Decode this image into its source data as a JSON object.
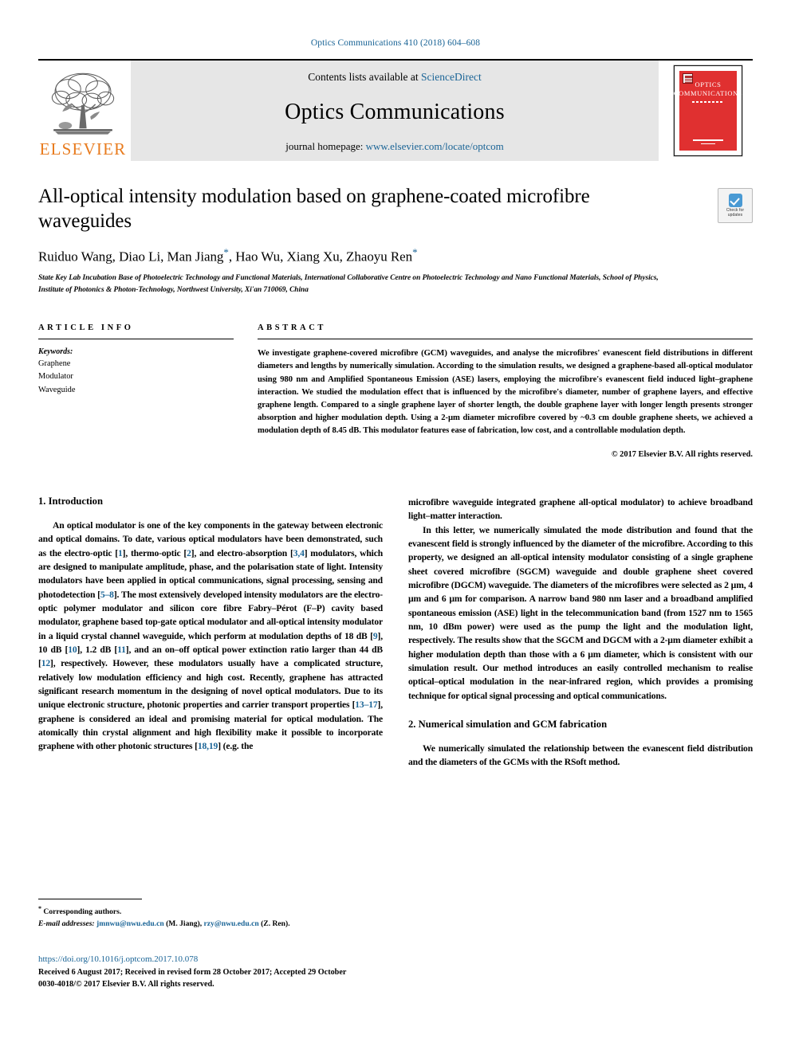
{
  "running_head": "Optics Communications 410 (2018) 604–608",
  "masthead": {
    "contents_prefix": "Contents lists available at ",
    "sciencedirect": "ScienceDirect",
    "journal_name": "Optics Communications",
    "homepage_prefix": "journal homepage: ",
    "homepage_url": "www.elsevier.com/locate/optcom",
    "publisher_wordmark": "ELSEVIER",
    "cover_title": "Optics Communications"
  },
  "article": {
    "title": "All-optical intensity modulation based on graphene-coated microfibre waveguides",
    "authors": "Ruiduo Wang, Diao Li, Man Jiang",
    "authors_mid": ", Hao Wu, Xiang Xu, Zhaoyu Ren",
    "corresponding_mark": "*",
    "affiliation": "State Key Lab Incubation Base of Photoelectric Technology and Functional Materials, International Collaborative Centre on Photoelectric Technology and Nano Functional Materials, School of Physics, Institute of Photonics & Photon-Technology, Northwest University, Xi'an 710069, China",
    "crossmark_label": "Check for updates"
  },
  "article_info": {
    "heading": "ARTICLE INFO",
    "keywords_label": "Keywords:",
    "keywords": [
      "Graphene",
      "Modulator",
      "Waveguide"
    ]
  },
  "abstract": {
    "heading": "ABSTRACT",
    "text": "We investigate graphene-covered microfibre (GCM) waveguides, and analyse the microfibres' evanescent field distributions in different diameters and lengths by numerically simulation. According to the simulation results, we designed a graphene-based all-optical modulator using 980 nm and Amplified Spontaneous Emission (ASE) lasers, employing the microfibre's evanescent field induced light–graphene interaction. We studied the modulation effect that is influenced by the microfibre's diameter, number of graphene layers, and effective graphene length. Compared to a single graphene layer of shorter length, the double graphene layer with longer length presents stronger absorption and higher modulation depth. Using a 2-µm diameter microfibre covered by ~0.3 cm double graphene sheets, we achieved a modulation depth of 8.45 dB. This modulator features ease of fabrication, low cost, and a controllable modulation depth.",
    "copyright": "© 2017 Elsevier B.V. All rights reserved."
  },
  "sections": {
    "intro_title": "1. Introduction",
    "intro_p1_a": "An optical modulator is one of the key components in the gateway between electronic and optical domains. To date, various optical modulators have been demonstrated, such as the electro-optic [",
    "ref1": "1",
    "intro_p1_b": "], thermo-optic [",
    "ref2": "2",
    "intro_p1_c": "], and electro-absorption [",
    "ref34": "3,4",
    "intro_p1_d": "] modulators, which are designed to manipulate amplitude, phase, and the polarisation state of light. Intensity modulators have been applied in optical communications, signal processing, sensing and photodetection [",
    "ref58": "5–8",
    "intro_p1_e": "]. The most extensively developed intensity modulators are the electro-optic polymer modulator and silicon core fibre Fabry–Pérot (F–P) cavity based modulator, graphene based top-gate optical modulator and all-optical intensity modulator in a liquid crystal channel waveguide, which perform at modulation depths of 18 dB [",
    "ref9": "9",
    "intro_p1_f": "], 10 dB [",
    "ref10": "10",
    "intro_p1_g": "], 1.2 dB [",
    "ref11": "11",
    "intro_p1_h": "], and an on–off optical power extinction ratio larger than 44 dB [",
    "ref12": "12",
    "intro_p1_i": "], respectively. However, these modulators usually have a complicated structure, relatively low modulation efficiency and high cost. Recently, graphene has attracted significant research momentum in the designing of novel optical modulators. Due to its unique electronic structure, photonic properties and carrier transport properties [",
    "ref1317": "13–17",
    "intro_p1_j": "], graphene is considered an ideal and promising material for optical modulation. The atomically thin crystal alignment and high flexibility make it possible to incorporate graphene with other photonic structures [",
    "ref1819": "18,19",
    "intro_p1_k": "] (e.g. the",
    "right_cont": "microfibre waveguide integrated graphene all-optical modulator) to achieve broadband light–matter interaction.",
    "right_p2": "In this letter, we numerically simulated the mode distribution and found that the evanescent field is strongly influenced by the diameter of the microfibre. According to this property, we designed an all-optical intensity modulator consisting of a single graphene sheet covered microfibre (SGCM) waveguide and double graphene sheet covered microfibre (DGCM) waveguide. The diameters of the microfibres were selected as 2 µm, 4 µm and 6 µm for comparison. A narrow band 980 nm laser and a broadband amplified spontaneous emission (ASE) light in the telecommunication band (from 1527 nm to 1565 nm, 10 dBm power) were used as the pump the light and the modulation light, respectively. The results show that the SGCM and DGCM with a 2-µm diameter exhibit a higher modulation depth than those with a 6 µm diameter, which is consistent with our simulation result. Our method introduces an easily controlled mechanism to realise optical–optical modulation in the near-infrared region, which provides a promising technique for optical signal processing and optical communications.",
    "sec2_title": "2. Numerical simulation and GCM fabrication",
    "sec2_p1": "We numerically simulated the relationship between the evanescent field distribution and the diameters of the GCMs with the RSoft method."
  },
  "footer": {
    "corresponding_star": "*",
    "corresponding_text": "Corresponding authors.",
    "email_label": "E-mail addresses:",
    "email1": "jmnwu@nwu.edu.cn",
    "email1_name": "(M. Jiang),",
    "email2": "rzy@nwu.edu.cn",
    "email2_name": "(Z. Ren).",
    "doi": "https://doi.org/10.1016/j.optcom.2017.10.078",
    "received": "Received 6 August 2017; Received in revised form 28 October 2017; Accepted 29 October",
    "issn_line": "0030-4018/© 2017 Elsevier B.V. All rights reserved."
  }
}
